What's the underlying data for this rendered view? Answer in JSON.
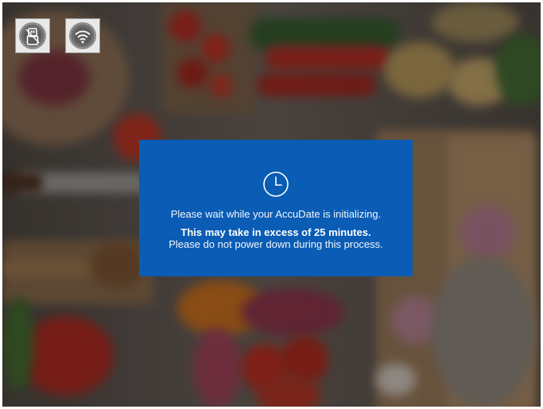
{
  "status_bar": {
    "icons": [
      {
        "name": "usb-drive-icon",
        "state": "disconnected"
      },
      {
        "name": "wifi-icon",
        "state": "disconnected"
      }
    ]
  },
  "dialog": {
    "icon": "clock-icon",
    "message": "Please wait while your AccuDate is initializing.",
    "emphasis": "This may take in excess of 25 minutes.",
    "note": "Please do not power down during this process."
  },
  "colors": {
    "dialog_background": "#0a5cb4",
    "dialog_text": "#ffffff",
    "status_tile": "#e9e9e9"
  }
}
